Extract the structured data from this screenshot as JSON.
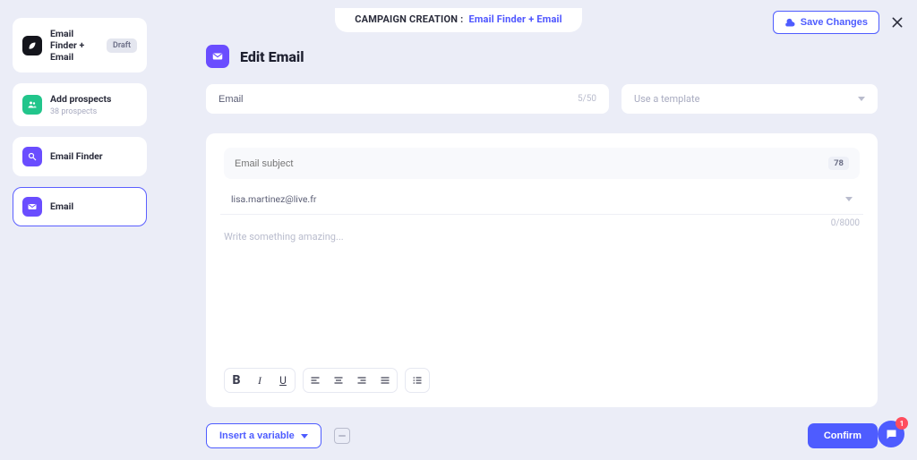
{
  "topbar": {
    "label": "CAMPAIGN CREATION :",
    "campaign_name": "Email Finder + Email",
    "save_label": "Save Changes"
  },
  "sidebar": {
    "steps": [
      {
        "title": "Email Finder + Email",
        "badge": "Draft"
      },
      {
        "title": "Add prospects",
        "sub": "38 prospects"
      },
      {
        "title": "Email Finder"
      },
      {
        "title": "Email"
      }
    ]
  },
  "main": {
    "header": "Edit Email",
    "name_value": "Email",
    "name_count": "5/50",
    "template_placeholder": "Use a template",
    "subject_placeholder": "Email subject",
    "subject_badge": "78",
    "from_email": "lisa.martinez@live.fr",
    "body_placeholder": "Write something amazing...",
    "body_count": "0/8000",
    "insert_label": "Insert a variable",
    "confirm_label": "Confirm"
  },
  "chat": {
    "badge": "1"
  }
}
